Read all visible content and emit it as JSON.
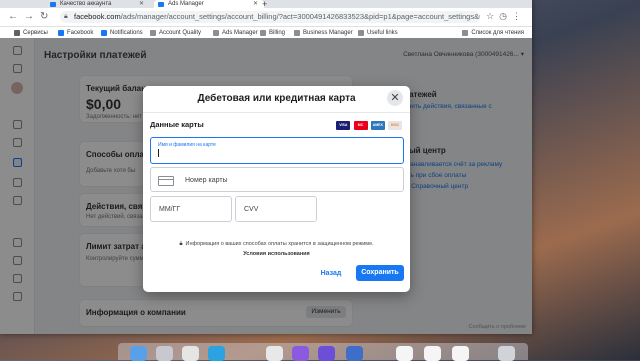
{
  "browser": {
    "tabs": [
      {
        "title": "Качество аккаунта"
      },
      {
        "title": "Ads Manager"
      }
    ],
    "url_host": "facebook.com",
    "url_path": "/ads/manager/account_settings/account_billing/?act=3000491426833523&pid=p1&page=account_settings&t...",
    "bookmarks": [
      "Сервисы",
      "Facebook",
      "Notifications",
      "Account Quality",
      "Ads Manager",
      "Billing",
      "Business Manager",
      "Useful links"
    ],
    "reading_list": "Список для чтения"
  },
  "page": {
    "title": "Настройки платежей",
    "account_selector": "Светлана Овчинникова (3000491426...",
    "balance_card": {
      "title": "Текущий балан",
      "amount": "$0,00",
      "note": "Задолженность: нет"
    },
    "payment_methods": {
      "title": "Способы оплат",
      "note": "Добавьте хотя бы"
    },
    "actions": {
      "title": "Действия, связ",
      "note": "Нет действий, связанных с"
    },
    "spend_limit": {
      "title": "Лимит затрат а",
      "note": "Контролируйте суммы"
    },
    "business_info": {
      "title": "Информация о компании",
      "edit": "Изменить"
    },
    "right_panel": {
      "header": "латежей",
      "line1": "ерить действия, связанные с",
      "line2": "и",
      "help_header": "ный центр",
      "help1": "станавливается счёт за рекламу",
      "help2": "ать при сбое оплаты",
      "help3": "и. Справочный центр"
    },
    "report_link": "Сообщить о проблеме"
  },
  "modal": {
    "title": "Дебетовая или кредитная карта",
    "section": "Данные карты",
    "card_logos": [
      "VISA",
      "MC",
      "AMEX",
      "DISC"
    ],
    "name_label": "Имя и фамилия на карте",
    "card_number_placeholder": "Номер карты",
    "expiry_placeholder": "ММ/ГГ",
    "cvv_placeholder": "CVV",
    "secure_note": "Информация о ваших способах оплаты хранится в защищенном режиме.",
    "terms_link": "Условия использования",
    "back_button": "Назад",
    "save_button": "Сохранить"
  },
  "colors": {
    "accent": "#1877f2"
  }
}
